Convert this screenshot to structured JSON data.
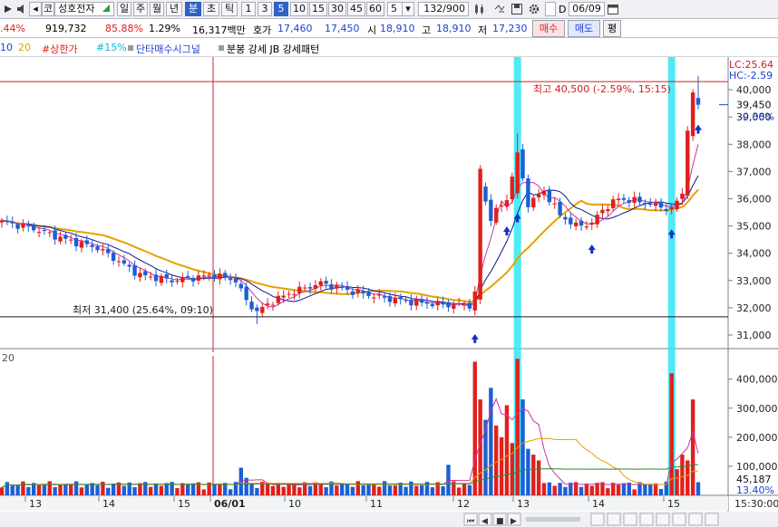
{
  "toolbar": {
    "code": "코",
    "stock_name": "성호전자",
    "period_buttons": [
      "일",
      "주",
      "월",
      "년",
      "분",
      "초",
      "틱"
    ],
    "active_period": "분",
    "intervals": [
      "1",
      "3",
      "5",
      "10",
      "15",
      "30",
      "45",
      "60"
    ],
    "active_interval": "5",
    "interval_select": "5",
    "count": "132/900",
    "date_checkbox_label": "D",
    "date": "06/09"
  },
  "quote": {
    "change_pct": ".44%",
    "volume": "919,732",
    "pct_a": "85.88%",
    "pct_b": "1.29%",
    "amount": "16,317백만",
    "ask_label": "호가",
    "ask_price": "17,460",
    "bid_price": "17,450",
    "open_label": "시",
    "open": "18,910",
    "high_label": "고",
    "high": "18,910",
    "low_label": "저",
    "low": "17,230",
    "buy_label": "매수",
    "sell_label": "매도",
    "eval_label": "평"
  },
  "legend": {
    "ma10": "10",
    "ma20": "20",
    "upper_limit": "#상한가",
    "pct15": "#15%",
    "signal": "단타매수시그널",
    "pattern": "분봉 강세 JB 강세패턴"
  },
  "chart_data": {
    "type": "candlestick",
    "upper_pane": {
      "ylim": [
        30500,
        41200
      ],
      "y_ticks": [
        "40,000",
        "39,000",
        "38,000",
        "37,000",
        "36,000",
        "35,000",
        "34,000",
        "33,000",
        "32,000",
        "31,000"
      ],
      "tick_values": [
        40000,
        39000,
        38000,
        37000,
        36000,
        35000,
        34000,
        33000,
        32000,
        31000
      ],
      "current_price": "39,450",
      "current_pct": "-0.38%",
      "lc_label": "LC:25.64",
      "hc_label": "HC:-2.59",
      "max_annotation": "최고 40,500 (-2.59%, 15:15)",
      "max_value": 40500,
      "min_annotation": "최저 31,400 (25.64%, 09:10)",
      "min_value": 31400,
      "reference_high": 40500,
      "reference_low": 31400
    },
    "lower_pane": {
      "label": "20",
      "ylim": [
        0,
        480000
      ],
      "y_ticks": [
        "400,000",
        "300,000",
        "200,000",
        "100,000"
      ],
      "tick_values": [
        400000,
        300000,
        200000,
        100000
      ],
      "current_volume": "45,187",
      "current_volume_pct": "13.40%"
    },
    "x_labels": [
      "13",
      "14",
      "15",
      "06/01",
      "10",
      "11",
      "12",
      "13",
      "14",
      "15"
    ],
    "time_label": "15:30:00",
    "colors": {
      "up": "#e0201c",
      "down": "#1c5fd4",
      "ma_short": "#0a1a8c",
      "ma_long": "#e6a000",
      "highlight": "#33e6f2",
      "signal": "#1030c8"
    }
  }
}
